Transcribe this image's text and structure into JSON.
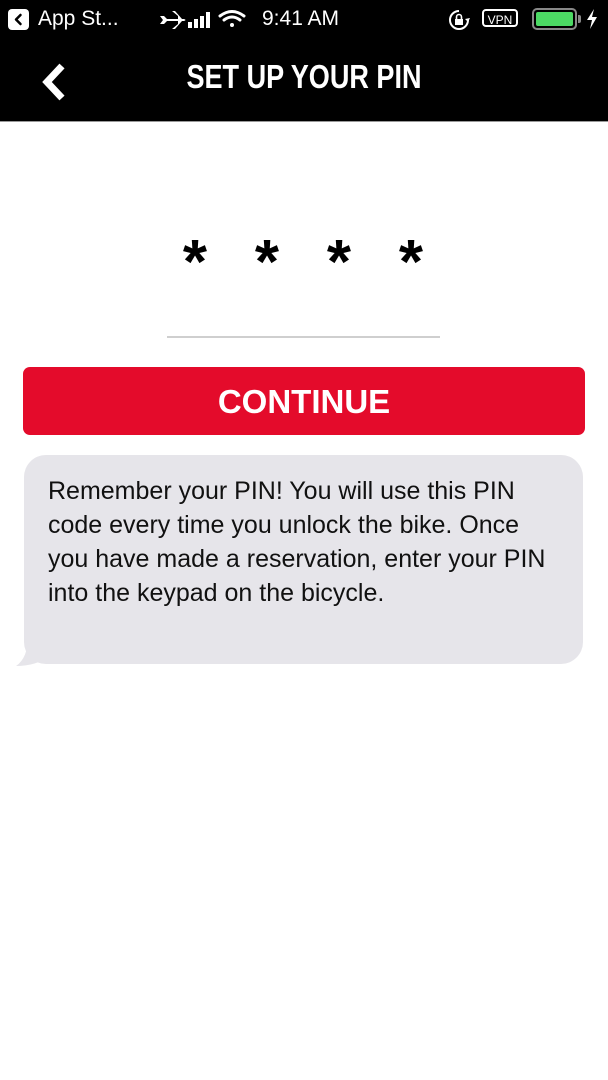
{
  "status_bar": {
    "back_app_label": "App St...",
    "time": "9:41 AM",
    "vpn_label": "VPN",
    "battery_level": 1.0,
    "icons": [
      "back-to-app-icon",
      "airplane-icon",
      "cellular-signal-icon",
      "wifi-icon",
      "rotation-lock-icon",
      "vpn-icon",
      "battery-icon",
      "charging-bolt-icon"
    ]
  },
  "nav": {
    "title": "SET UP YOUR PIN",
    "back_icon": "chevron-left-icon"
  },
  "pin": {
    "masked_digits": [
      "*",
      "*",
      "*",
      "*"
    ]
  },
  "continue_button": {
    "label": "CONTINUE",
    "color": "#e40b2b"
  },
  "info": {
    "message": "Remember your PIN! You will use this PIN code every time you unlock the bike. Once you have made a reservation, enter your PIN into the keypad on the bicycle."
  }
}
